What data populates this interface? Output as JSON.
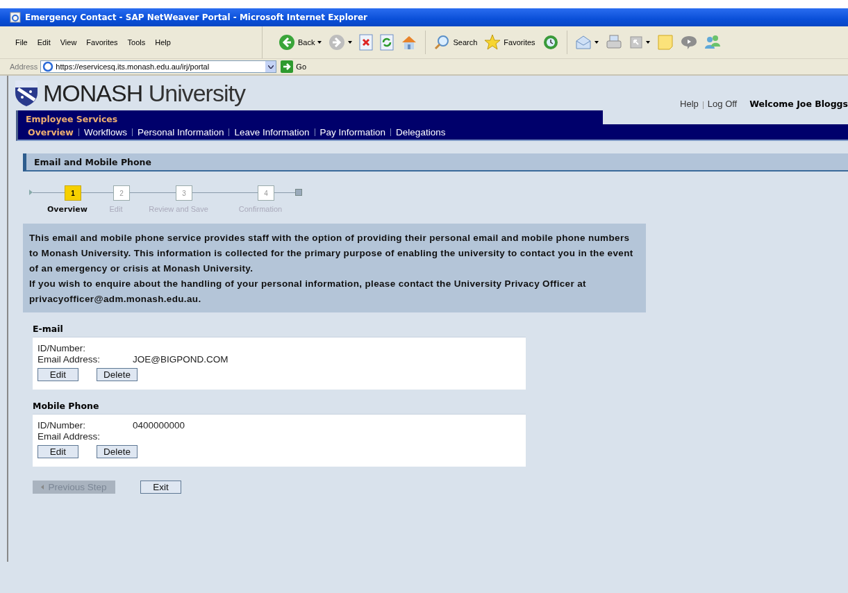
{
  "window": {
    "title": "Emergency Contact - SAP NetWeaver Portal - Microsoft Internet Explorer"
  },
  "menu": [
    "File",
    "Edit",
    "View",
    "Favorites",
    "Tools",
    "Help"
  ],
  "toolbar": [
    {
      "kind": "back",
      "label": "Back",
      "dropdown": true
    },
    {
      "kind": "forward",
      "dropdown": true
    },
    {
      "kind": "stop"
    },
    {
      "kind": "refresh"
    },
    {
      "kind": "home"
    },
    {
      "kind": "search",
      "label": "Search"
    },
    {
      "kind": "favorites",
      "label": "Favorites"
    },
    {
      "kind": "history"
    },
    {
      "kind": "mail",
      "dropdown": true
    },
    {
      "kind": "print"
    },
    {
      "kind": "edit",
      "dropdown": true
    },
    {
      "kind": "note"
    },
    {
      "kind": "discuss"
    },
    {
      "kind": "messenger"
    }
  ],
  "address": {
    "label": "Address",
    "url": "https://eservicesq.its.monash.edu.au/irj/portal",
    "go": "Go"
  },
  "header": {
    "brand": "MONASH",
    "brand_suffix": "University",
    "links": [
      "Help",
      "Log Off"
    ],
    "welcome": "Welcome Joe Bloggs"
  },
  "nav": {
    "title": "Employee Services",
    "tabs": [
      {
        "label": "Overview",
        "selected": true
      },
      {
        "label": "Workflows",
        "selected": false
      },
      {
        "label": "Personal Information",
        "selected": false
      },
      {
        "label": "Leave Information",
        "selected": false
      },
      {
        "label": "Pay Information",
        "selected": false
      },
      {
        "label": "Delegations",
        "selected": false
      }
    ]
  },
  "section_title": "Email and Mobile Phone",
  "steps": [
    {
      "number": "1",
      "label": "Overview",
      "selected": true
    },
    {
      "number": "2",
      "label": "Edit",
      "selected": false
    },
    {
      "number": "3",
      "label": "Review and Save",
      "selected": false
    },
    {
      "number": "4",
      "label": "Confirmation",
      "selected": false
    }
  ],
  "info": [
    "This email and mobile phone service provides staff with the option of providing their personal email and mobile phone numbers to Monash University.  This information is collected for the primary purpose of enabling the university to contact you in the event of an emergency or crisis at Monash University.",
    "If you wish to enquire about the handling of your personal information, please contact the University Privacy Officer at privacyofficer@adm.monash.edu.au."
  ],
  "records": [
    {
      "title": "E-mail",
      "fields": [
        {
          "label": "ID/Number:"
        },
        {
          "label": "Email Address:",
          "value": "JOE@BIGPOND.COM"
        }
      ],
      "buttons": [
        "Edit",
        "Delete"
      ]
    },
    {
      "title": "Mobile Phone",
      "fields": [
        {
          "label": "ID/Number:",
          "value": "0400000000"
        },
        {
          "label": "Email Address:"
        }
      ],
      "buttons": [
        "Edit",
        "Delete"
      ]
    }
  ],
  "footer_buttons": [
    {
      "label": "Previous Step",
      "disabled": true,
      "arrow": true
    },
    {
      "label": "Exit",
      "disabled": false
    }
  ]
}
